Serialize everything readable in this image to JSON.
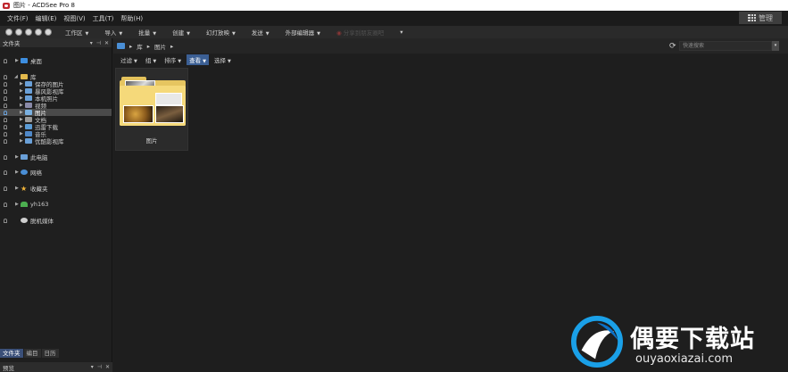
{
  "window": {
    "title": "图片 - ACDSee Pro 8"
  },
  "menu": [
    "文件(F)",
    "编辑(E)",
    "视图(V)",
    "工具(T)",
    "帮助(H)"
  ],
  "manage_label": "管理",
  "toolbar": {
    "items": [
      "工作区",
      "导入",
      "批量",
      "创建",
      "幻灯放映",
      "发送",
      "外部编辑器"
    ],
    "share_label": "分享到朋友圈吧"
  },
  "left_panel": {
    "title": "文件夹",
    "tree": {
      "desktop": "桌面",
      "library": "库",
      "saved_pictures": "保存的图片",
      "video_library": "暴风影视库",
      "camera_roll": "本机照片",
      "videos": "视频",
      "pictures": "图片",
      "documents": "文档",
      "thunder": "迅雷下载",
      "music": "音乐",
      "youku": "优酷影视库",
      "this_pc": "此电脑",
      "network": "网络",
      "favorites": "收藏夹",
      "user": "yh163",
      "offline_media": "脱机媒体"
    },
    "tabs": [
      "文件夹",
      "编目",
      "日历"
    ]
  },
  "preview": {
    "title": "预览"
  },
  "address": {
    "path": [
      "库",
      "图片"
    ],
    "search_placeholder": "快速搜索"
  },
  "filter_bar": [
    "过滤",
    "组",
    "排序",
    "查看",
    "选择"
  ],
  "thumbnail": {
    "label": "图片"
  },
  "watermark": {
    "title": "偶要下载站",
    "url": "ouyaoxiazai.com"
  },
  "colors": {
    "accent": "#3b5f94",
    "background": "#1f1f1f",
    "folder": "#f5d97a"
  }
}
